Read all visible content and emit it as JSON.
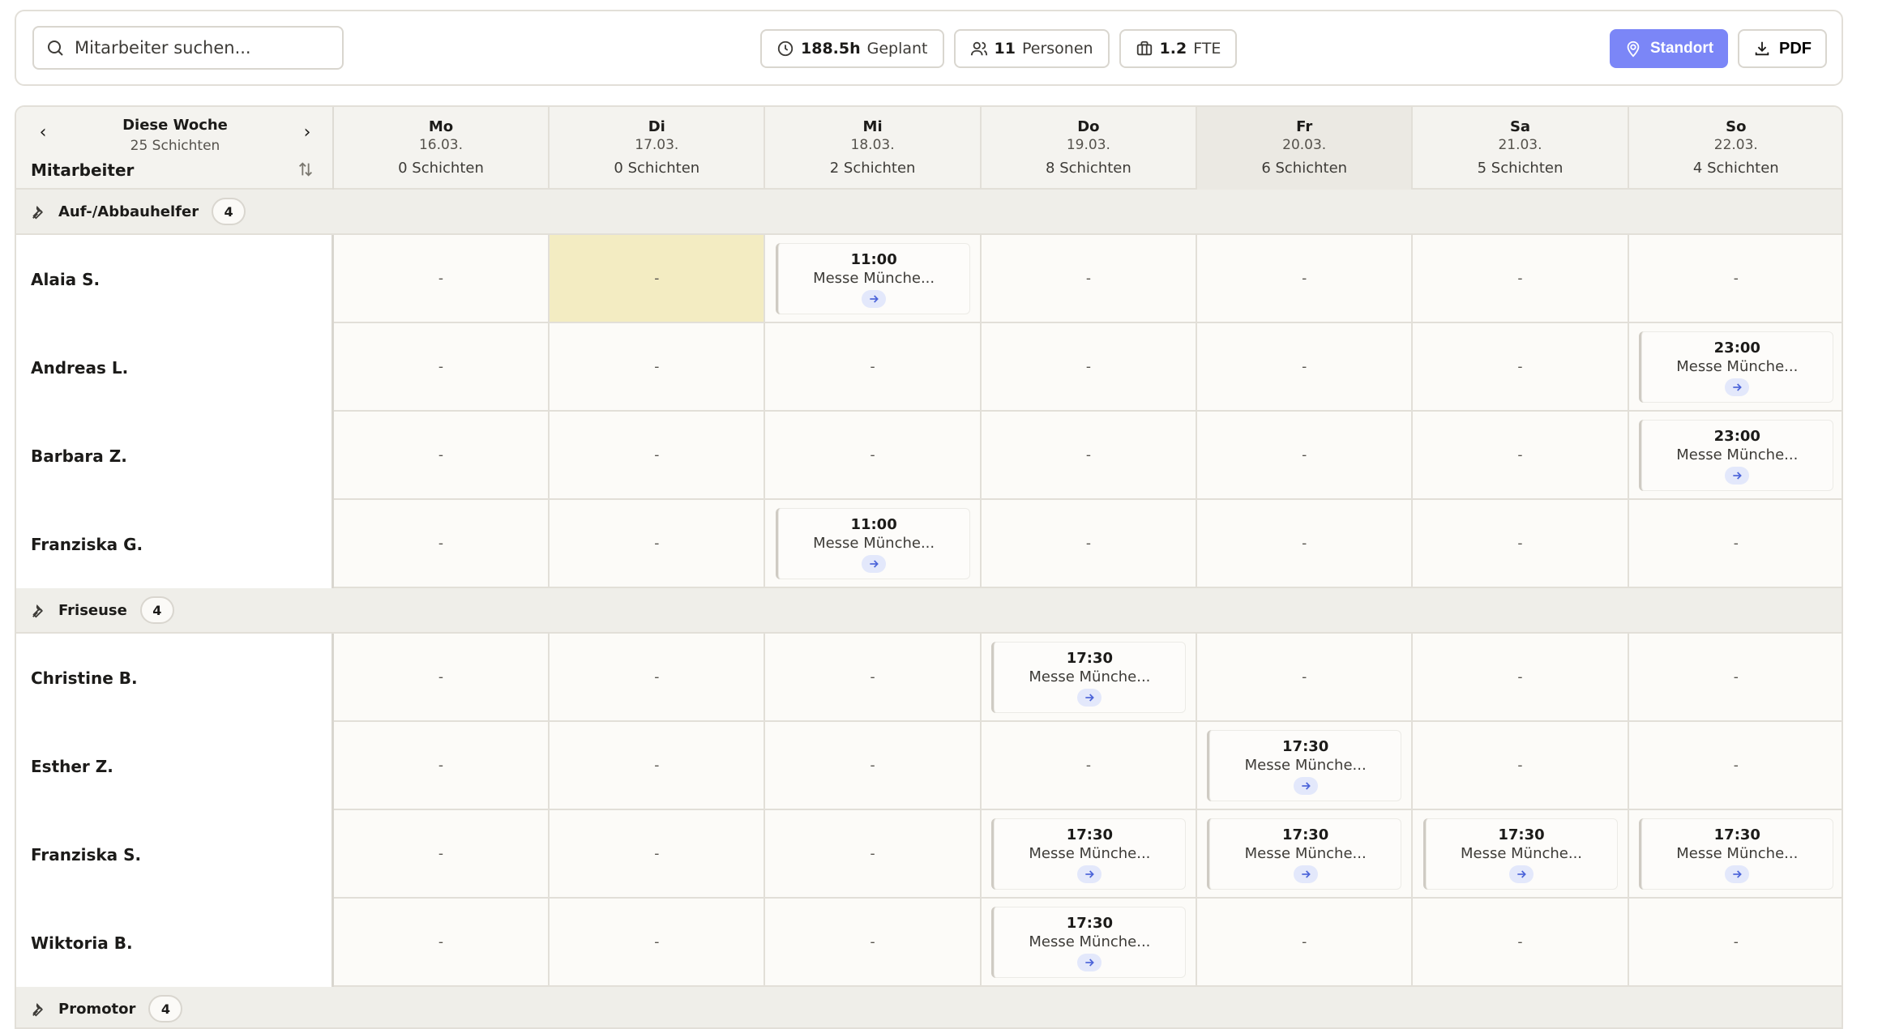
{
  "search": {
    "placeholder": "Mitarbeiter suchen..."
  },
  "stats": [
    {
      "icon": "clock-icon",
      "num": "188.5h",
      "label": "Geplant"
    },
    {
      "icon": "users-icon",
      "num": "11",
      "label": "Personen"
    },
    {
      "icon": "briefcase-icon",
      "num": "1.2",
      "label": "FTE"
    }
  ],
  "actions": {
    "standort": "Standort",
    "pdf": "PDF"
  },
  "colors": {
    "accent": "#7b86f7",
    "highlight": "#f3ecc2"
  },
  "week": {
    "label": "Diese Woche",
    "sub": "25 Schichten",
    "column_title": "Mitarbeiter"
  },
  "days": [
    {
      "name": "Mo",
      "date": "16.03.",
      "count": "0 Schichten",
      "today": false
    },
    {
      "name": "Di",
      "date": "17.03.",
      "count": "0 Schichten",
      "today": false
    },
    {
      "name": "Mi",
      "date": "18.03.",
      "count": "2 Schichten",
      "today": false
    },
    {
      "name": "Do",
      "date": "19.03.",
      "count": "8 Schichten",
      "today": false
    },
    {
      "name": "Fr",
      "date": "20.03.",
      "count": "6 Schichten",
      "today": true
    },
    {
      "name": "Sa",
      "date": "21.03.",
      "count": "5 Schichten",
      "today": false
    },
    {
      "name": "So",
      "date": "22.03.",
      "count": "4 Schichten",
      "today": false
    }
  ],
  "empty_cell": "-",
  "shift_location": "Messe Münche...",
  "groups": [
    {
      "name": "Auf-/Abbauhelfer",
      "count": "4",
      "employees": [
        {
          "name": "Alaia S.",
          "shifts": [
            null,
            null,
            "11:00",
            null,
            null,
            null,
            null
          ],
          "highlight_day": 1
        },
        {
          "name": "Andreas L.",
          "shifts": [
            null,
            null,
            null,
            null,
            null,
            null,
            "23:00"
          ]
        },
        {
          "name": "Barbara Z.",
          "shifts": [
            null,
            null,
            null,
            null,
            null,
            null,
            "23:00"
          ]
        },
        {
          "name": "Franziska G.",
          "shifts": [
            null,
            null,
            "11:00",
            null,
            null,
            null,
            null
          ]
        }
      ]
    },
    {
      "name": "Friseuse",
      "count": "4",
      "employees": [
        {
          "name": "Christine B.",
          "shifts": [
            null,
            null,
            null,
            "17:30",
            null,
            null,
            null
          ]
        },
        {
          "name": "Esther Z.",
          "shifts": [
            null,
            null,
            null,
            null,
            "17:30",
            null,
            null
          ]
        },
        {
          "name": "Franziska S.",
          "shifts": [
            null,
            null,
            null,
            "17:30",
            "17:30",
            "17:30",
            "17:30"
          ]
        },
        {
          "name": "Wiktoria B.",
          "shifts": [
            null,
            null,
            null,
            "17:30",
            null,
            null,
            null
          ]
        }
      ]
    },
    {
      "name": "Promotor",
      "count": "4",
      "employees": []
    }
  ]
}
